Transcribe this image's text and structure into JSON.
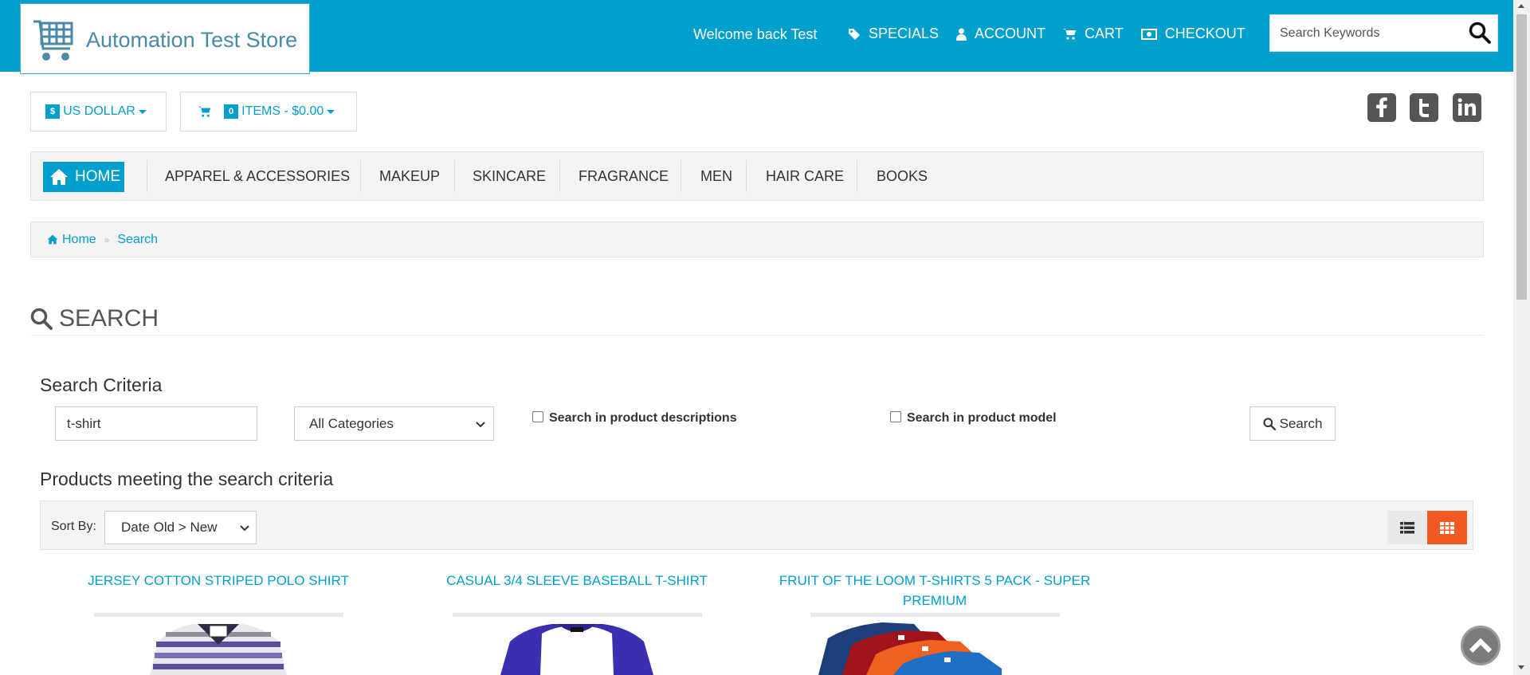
{
  "header": {
    "store_name": "Automation Test Store",
    "welcome": "Welcome back Test",
    "nav": [
      {
        "label": "Specials",
        "icon": "tag-icon"
      },
      {
        "label": "Account",
        "icon": "user-icon"
      },
      {
        "label": "Cart",
        "icon": "cart-icon"
      },
      {
        "label": "Checkout",
        "icon": "money-icon"
      }
    ],
    "search_placeholder": "Search Keywords"
  },
  "toolbar": {
    "currency_symbol": "$",
    "currency_label": "US DOLLAR",
    "cart_count": "0",
    "cart_label": "ITEMS - $0.00"
  },
  "social": [
    "facebook-icon",
    "twitter-icon",
    "linkedin-icon"
  ],
  "category_nav": {
    "home": "HOME",
    "items": [
      "APPAREL & ACCESSORIES",
      "MAKEUP",
      "SKINCARE",
      "FRAGRANCE",
      "MEN",
      "HAIR CARE",
      "BOOKS"
    ]
  },
  "breadcrumb": {
    "home": "Home",
    "current": "Search"
  },
  "page_title": "SEARCH",
  "criteria": {
    "title": "Search Criteria",
    "keyword": "t-shirt",
    "category": "All Categories",
    "desc_checkbox": "Search in product descriptions",
    "model_checkbox": "Search in product model",
    "search_button": "Search"
  },
  "results": {
    "title": "Products meeting the search criteria",
    "sort_label": "Sort By:",
    "sort_value": "Date Old > New"
  },
  "products": [
    {
      "name": "JERSEY COTTON STRIPED POLO SHIRT"
    },
    {
      "name": "CASUAL 3/4 SLEEVE BASEBALL T-SHIRT"
    },
    {
      "name": "FRUIT OF THE LOOM T-SHIRTS 5 PACK - SUPER PREMIUM"
    }
  ],
  "colors": {
    "accent": "#009fcc",
    "active_view": "#f15a22"
  }
}
